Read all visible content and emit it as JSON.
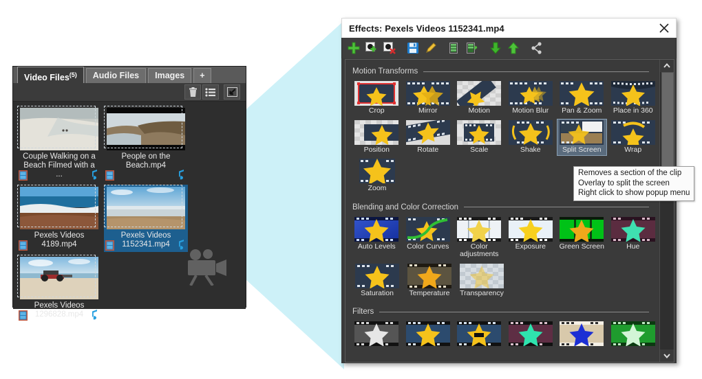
{
  "media_panel": {
    "tabs": [
      {
        "label": "Video Files",
        "count": "(5)",
        "active": true
      },
      {
        "label": "Audio Files",
        "count": "",
        "active": false
      },
      {
        "label": "Images",
        "count": "",
        "active": false
      },
      {
        "label": "+",
        "count": "",
        "active": false
      }
    ],
    "toolbar": [
      {
        "name": "delete-icon",
        "title": "Delete"
      },
      {
        "name": "list-view-icon",
        "title": "List view"
      },
      {
        "name": "collapse-icon",
        "title": "Collapse"
      }
    ],
    "thumbnails": [
      {
        "caption": "Couple Walking on a Beach Filmed with a ...",
        "selected": false,
        "scene": "beach-sand"
      },
      {
        "caption": "People on the Beach.mp4",
        "selected": false,
        "scene": "cliff"
      },
      {
        "caption": "Pexels Videos 4189.mp4",
        "selected": false,
        "scene": "surf"
      },
      {
        "caption": "Pexels Videos 1152341.mp4",
        "selected": true,
        "scene": "flat-beach"
      },
      {
        "caption": "Pexels Videos 1296828.mp4",
        "selected": false,
        "scene": "tractor"
      }
    ],
    "watermark_icon": "video-camera-icon"
  },
  "effects_window": {
    "title": "Effects: Pexels Videos 1152341.mp4",
    "close_label": "✕",
    "toolbar": [
      {
        "name": "add-effect-icon",
        "title": "Add effect"
      },
      {
        "name": "add-keyframe-icon",
        "title": "Add keyframe"
      },
      {
        "name": "remove-keyframe-icon",
        "title": "Remove keyframe"
      },
      {
        "name": "save-preset-icon",
        "title": "Save preset"
      },
      {
        "name": "edit-icon",
        "title": "Edit"
      },
      {
        "name": "copy-effect-icon",
        "title": "Copy effect"
      },
      {
        "name": "paste-effect-icon",
        "title": "Paste effect"
      },
      {
        "name": "move-down-icon",
        "title": "Move down"
      },
      {
        "name": "move-up-icon",
        "title": "Move up"
      },
      {
        "name": "share-icon",
        "title": "Share"
      }
    ],
    "groups": [
      {
        "title": "Motion  Transforms",
        "items": [
          {
            "label": "Crop",
            "style": "crop",
            "selected": false
          },
          {
            "label": "Mirror",
            "style": "mirror",
            "selected": false
          },
          {
            "label": "Motion",
            "style": "motion",
            "selected": false
          },
          {
            "label": "Motion Blur",
            "style": "motionblur",
            "selected": false
          },
          {
            "label": "Pan & Zoom",
            "style": "panzoom",
            "selected": false
          },
          {
            "label": "Place in 360",
            "style": "place360",
            "selected": false
          },
          {
            "label": "Position",
            "style": "position",
            "selected": false
          },
          {
            "label": "Rotate",
            "style": "rotate",
            "selected": false
          },
          {
            "label": "Scale",
            "style": "scale",
            "selected": false
          },
          {
            "label": "Shake",
            "style": "shake",
            "selected": false
          },
          {
            "label": "Split Screen",
            "style": "splitscreen",
            "selected": true
          },
          {
            "label": "Wrap",
            "style": "wrap",
            "selected": false
          },
          {
            "label": "Zoom",
            "style": "zoomfx",
            "selected": false
          }
        ]
      },
      {
        "title": "Blending and Color Correction",
        "items": [
          {
            "label": "Auto Levels",
            "style": "autolevels",
            "selected": false
          },
          {
            "label": "Color Curves",
            "style": "colorcurves",
            "selected": false
          },
          {
            "label": "Color adjustments",
            "style": "coloradj",
            "selected": false
          },
          {
            "label": "Exposure",
            "style": "exposure",
            "selected": false
          },
          {
            "label": "Green Screen",
            "style": "greenscreen",
            "selected": false
          },
          {
            "label": "Hue",
            "style": "hue",
            "selected": false
          },
          {
            "label": "Saturation",
            "style": "saturation",
            "selected": false
          },
          {
            "label": "Temperature",
            "style": "temperature",
            "selected": false
          },
          {
            "label": "Transparency",
            "style": "transparency",
            "selected": false
          }
        ]
      },
      {
        "title": "Filters",
        "items": [
          {
            "label": "",
            "style": "f-gray",
            "selected": false
          },
          {
            "label": "",
            "style": "f-yellow",
            "selected": false
          },
          {
            "label": "",
            "style": "f-bar",
            "selected": false
          },
          {
            "label": "",
            "style": "f-teal",
            "selected": false
          },
          {
            "label": "",
            "style": "f-blue",
            "selected": false
          },
          {
            "label": "",
            "style": "f-green",
            "selected": false
          }
        ]
      }
    ],
    "scrollbar": {
      "up": "▲",
      "down": "▼"
    }
  },
  "tooltip": {
    "lines": [
      "Removes a section of the clip",
      "Overlay to split the screen",
      "Right click to show popup menu"
    ]
  },
  "colors": {
    "cone": "#cdf1f8",
    "cone_dark": "#1f6b72",
    "panel_bg": "#2e2e2e",
    "selection_blue": "#1d5f8f",
    "fx_bg": "#3a3a3a",
    "fx_select": "#5a6b7d",
    "star_gold": "#f5c21b"
  }
}
